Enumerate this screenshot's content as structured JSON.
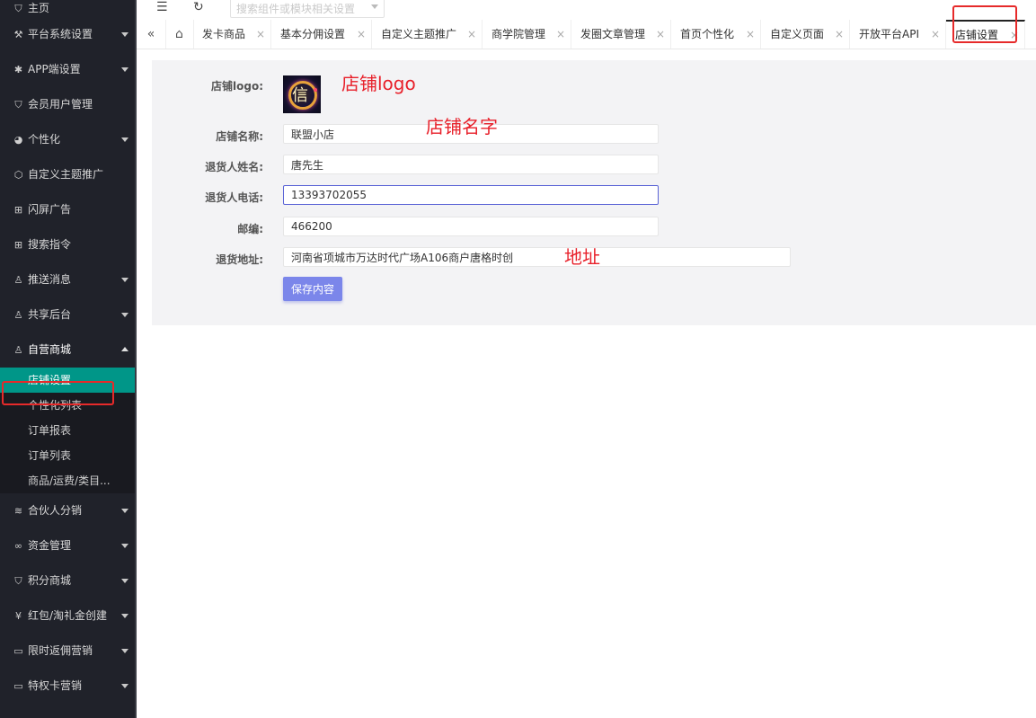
{
  "sidebar": {
    "items": [
      {
        "label": "主页",
        "icon": "shield-check-icon",
        "glyph": "⛉"
      },
      {
        "label": "平台系统设置",
        "icon": "tools-icon",
        "glyph": "⚒"
      },
      {
        "label": "APP端设置",
        "icon": "gear-icon",
        "glyph": "✱"
      },
      {
        "label": "会员用户管理",
        "icon": "shield-check-icon",
        "glyph": "⛉"
      },
      {
        "label": "个性化",
        "icon": "palette-icon",
        "glyph": "◕"
      },
      {
        "label": "自定义主题推广",
        "icon": "cube-icon",
        "glyph": "⬡"
      },
      {
        "label": "闪屏广告",
        "icon": "grid-icon",
        "glyph": "⊞"
      },
      {
        "label": "搜索指令",
        "icon": "grid-icon",
        "glyph": "⊞"
      },
      {
        "label": "推送消息",
        "icon": "user-icon",
        "glyph": "♙"
      },
      {
        "label": "共享后台",
        "icon": "user-icon",
        "glyph": "♙"
      },
      {
        "label": "自营商城",
        "icon": "user-icon",
        "glyph": "♙"
      }
    ],
    "submenu": [
      {
        "label": "店铺设置"
      },
      {
        "label": "个性化列表"
      },
      {
        "label": "订单报表"
      },
      {
        "label": "订单列表"
      },
      {
        "label": "商品/运费/类目..."
      }
    ],
    "items_after": [
      {
        "label": "合伙人分销",
        "icon": "layers-icon",
        "glyph": "≋"
      },
      {
        "label": "资金管理",
        "icon": "link-icon",
        "glyph": "∞"
      },
      {
        "label": "积分商城",
        "icon": "shield-check-icon",
        "glyph": "⛉"
      },
      {
        "label": "红包/淘礼金创建",
        "icon": "yen-icon",
        "glyph": "¥"
      },
      {
        "label": "限时返佣营销",
        "icon": "card-icon",
        "glyph": "▭"
      },
      {
        "label": "特权卡营销",
        "icon": "card-icon",
        "glyph": "▭"
      }
    ]
  },
  "topbar": {
    "menu_icon": "☰",
    "refresh_icon": "↻",
    "search_placeholder": "搜索组件或模块相关设置"
  },
  "tabs": {
    "prev_glyph": "«",
    "home_glyph": "⌂",
    "close_glyph": "×",
    "items": [
      "发卡商品",
      "基本分佣设置",
      "自定义主题推广",
      "商学院管理",
      "发圈文章管理",
      "首页个性化",
      "自定义页面",
      "开放平台API",
      "店铺设置"
    ]
  },
  "form": {
    "logo_label": "店铺logo:",
    "logo_glyph": "信",
    "name_label": "店铺名称:",
    "name_value": "联盟小店",
    "contact_label": "退货人姓名:",
    "contact_value": "唐先生",
    "phone_label": "退货人电话:",
    "phone_value": "13393702055",
    "zip_label": "邮编:",
    "zip_value": "466200",
    "address_label": "退货地址:",
    "address_value": "河南省项城市万达时代广场A106商户唐格时创",
    "save_label": "保存内容"
  },
  "annotations": {
    "logo": "店铺logo",
    "name": "店铺名字",
    "address": "地址"
  },
  "colors": {
    "sidebar_bg": "#20222a",
    "active_green": "#009688",
    "primary_button": "#7b86ea",
    "highlight_red": "#e62a2a"
  }
}
